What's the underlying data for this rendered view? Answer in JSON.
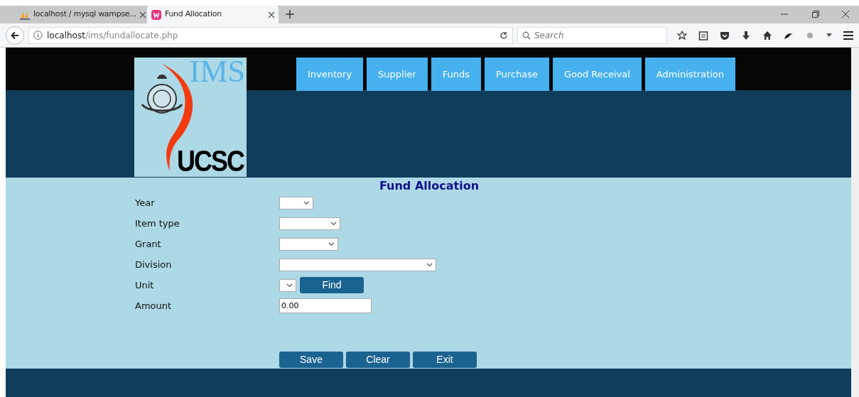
{
  "browser": {
    "tabs": [
      {
        "title": "localhost / mysql wampse...",
        "selected": false,
        "kind": "pma"
      },
      {
        "title": "Fund Allocation",
        "selected": true,
        "kind": "wamp"
      }
    ],
    "url": {
      "host": "localhost",
      "path": "/ims/fundallocate.php"
    },
    "search": {
      "placeholder": "Search"
    }
  },
  "header": {
    "logo": {
      "top_text": "IMS",
      "bottom_text": "UCSC"
    },
    "nav": [
      "Inventory",
      "Supplier",
      "Funds",
      "Purchase",
      "Good Receival",
      "Administration"
    ]
  },
  "form": {
    "title": "Fund Allocation",
    "fields": [
      {
        "label": "Year",
        "kind": "select"
      },
      {
        "label": "Item type",
        "kind": "select"
      },
      {
        "label": "Grant",
        "kind": "select"
      },
      {
        "label": "Division",
        "kind": "select"
      },
      {
        "label": "Unit",
        "kind": "select",
        "button": "Find"
      },
      {
        "label": "Amount",
        "kind": "input",
        "value": "0.00"
      }
    ],
    "buttons": [
      "Save",
      "Clear",
      "Exit"
    ]
  }
}
